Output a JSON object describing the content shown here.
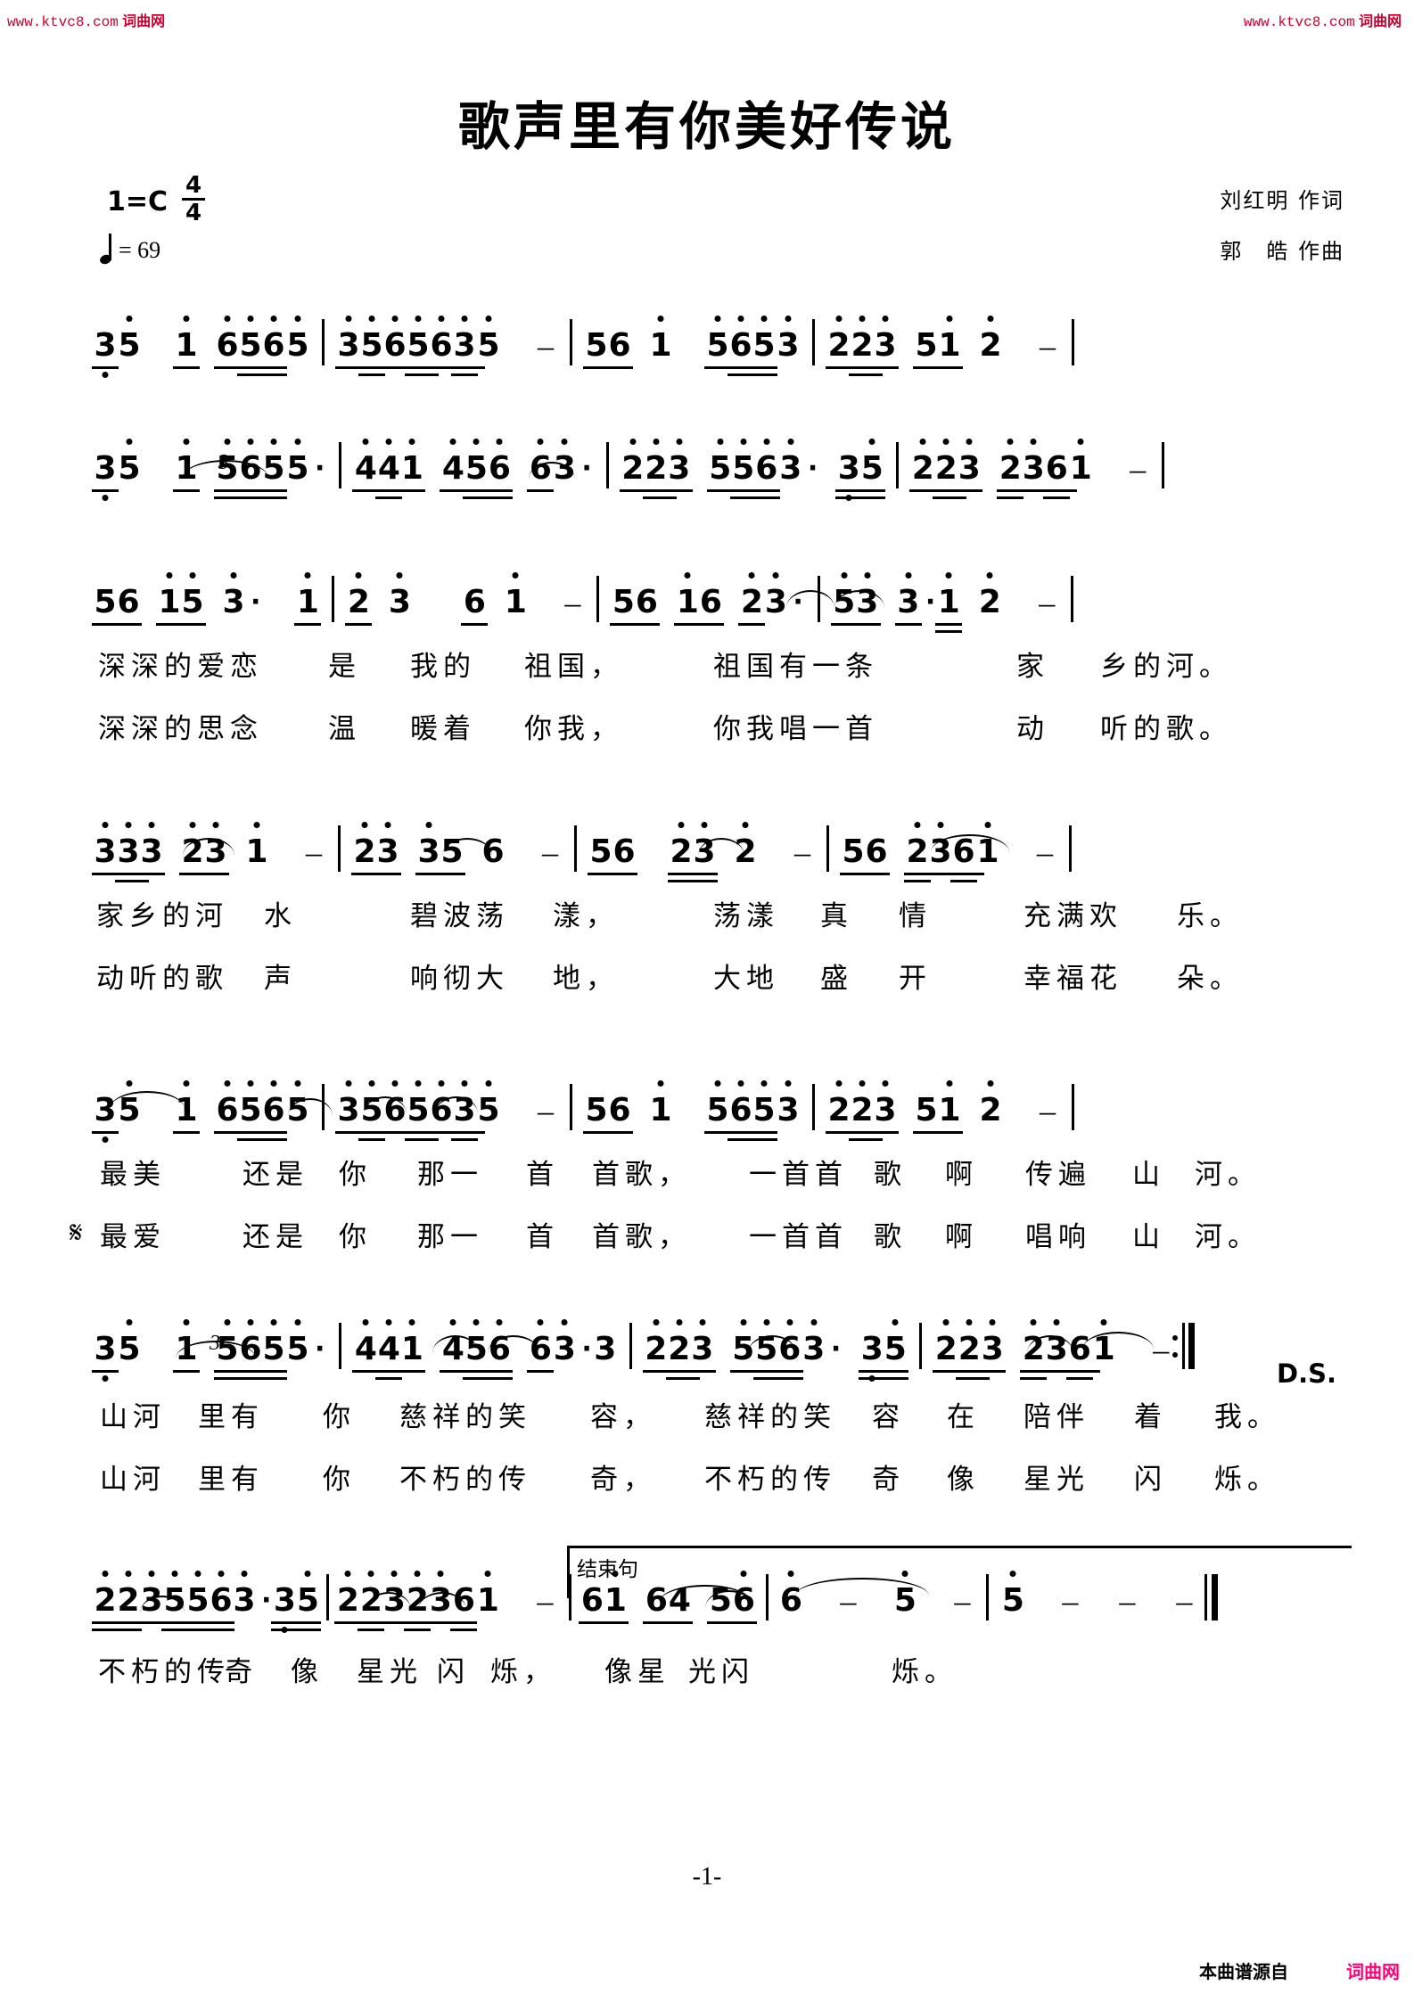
{
  "watermark": {
    "left_url": "www.ktvc8.com",
    "left_cn": "词曲网",
    "right_url": "www.ktvc8.com",
    "right_cn": "词曲网"
  },
  "header": {
    "title": "歌声里有你美好传说",
    "key_label": "1=C",
    "time_numerator": "4",
    "time_denominator": "4",
    "tempo_equals": "= 69",
    "lyricist": "刘红明 作词",
    "composer": "郭　皓 作曲"
  },
  "marks": {
    "segno": "𝄋",
    "ds": "D.S.",
    "ending_label": "结束句",
    "triplet": "3"
  },
  "page_number": "-1-",
  "footer": {
    "source_label": "本曲谱源自",
    "site_label": "词曲网"
  },
  "chart_data": {
    "type": "table",
    "title": "歌声里有你美好传说 — 简谱",
    "key": "1=C",
    "meter": "4/4",
    "tempo_bpm": 69,
    "systems": [
      {
        "index": 1,
        "measures": [
          [
            "3̣",
            "5̇",
            "1̇",
            "6",
            "5",
            "6",
            "5̇"
          ],
          [
            "3",
            "5",
            "6",
            "5",
            "6",
            "3",
            "5",
            "-"
          ],
          [
            "5",
            "6",
            "1̇",
            "5",
            "6",
            "5",
            "3"
          ],
          [
            "2̇",
            "2̇",
            "3",
            "5",
            "1",
            "2̇",
            "-"
          ]
        ],
        "lyrics": []
      },
      {
        "index": 2,
        "measures": [
          [
            "3̣",
            "5̇",
            "1̇",
            "5",
            "6",
            "5",
            "5",
            "."
          ],
          [
            "4",
            "4",
            "1",
            "4",
            "5",
            "6",
            "6",
            "3",
            "."
          ],
          [
            "2̇",
            "2̇",
            "3",
            "5",
            "5",
            "6",
            "3",
            ".",
            "3̣",
            "5"
          ],
          [
            "2̇",
            "2̇",
            "3̇",
            "2̇",
            "3",
            "6",
            "1̇",
            "-"
          ]
        ],
        "triplet_on": "measure 1 notes 5-6-5"
      },
      {
        "index": 3,
        "measures": [
          [
            "5",
            "6",
            "1̇",
            "5̇",
            "3̇",
            ".",
            "1̇"
          ],
          [
            "2̇",
            "3̇",
            "6",
            "1̇",
            "-"
          ],
          [
            "5",
            "6",
            "1̇",
            "6",
            "2̇",
            "3̇",
            "."
          ],
          [
            "5̇",
            "3̇",
            "3̇",
            ".",
            "1̇",
            "2̇",
            "-"
          ]
        ],
        "lyrics_line1": "深深的爱恋　是　我的　祖国，　祖国有一条　　家　乡的河。",
        "lyrics_line2": "深深的思念　温　暖着　你我，　你我唱一首　　动　听的歌。"
      },
      {
        "index": 4,
        "measures": [
          [
            "3̇",
            "3̇",
            "3̇",
            "2̇",
            "3̇",
            "1̇",
            "-"
          ],
          [
            "2̇",
            "3̇",
            "3̇",
            "5",
            "6",
            "-"
          ],
          [
            "5",
            "6",
            "2̇",
            "3̇",
            "2̇",
            "-"
          ],
          [
            "5",
            "6",
            "2̇",
            "3",
            "6",
            "1̇",
            "-"
          ]
        ],
        "lyrics_line1": "家乡的河　水　　碧波荡　漾，　荡漾　真　情　　充满欢　乐。",
        "lyrics_line2": "动听的歌　声　　响彻大　地，　大地　盛　开　　幸福花　朵。"
      },
      {
        "index": 5,
        "measures": [
          [
            "3̣",
            "5̇",
            "1̇",
            "6",
            "5",
            "6",
            "5̇"
          ],
          [
            "3",
            "5",
            "6",
            "5",
            "6",
            "3",
            "5",
            "-"
          ],
          [
            "5",
            "6",
            "1̇",
            "5",
            "6",
            "5",
            "3"
          ],
          [
            "2̇",
            "2̇",
            "3",
            "5",
            "1",
            "2̇",
            "-"
          ]
        ],
        "lyrics_line1": "最美　　还是　你　那一　首　首歌，　一首首　歌　啊　传遍　山　河。",
        "lyrics_line2": "最爱　　还是　你　那一　首　首歌，　一首首　歌　啊　唱响　山　河。"
      },
      {
        "index": 6,
        "measures": [
          [
            "3̣",
            "5̇",
            "1̇",
            "5",
            "6",
            "5",
            "5",
            "."
          ],
          [
            "4",
            "4",
            "1",
            "4",
            "5",
            "6",
            "6",
            "3",
            ".",
            "3"
          ],
          [
            "2̇",
            "2̇",
            "3",
            "5",
            "5",
            "6",
            "3",
            ".",
            "3̣",
            "5"
          ],
          [
            "2̇",
            "2̇",
            "3̇",
            "2̇",
            "3",
            "6",
            "1̇",
            "-"
          ]
        ],
        "lyrics_line1": "山河　里有　你　　慈祥的笑　　容，　慈祥的笑　容　在　陪伴　着　我。",
        "lyrics_line2": "山河　里有　你　　不朽的传　　奇，　不朽的传　奇　像　星光　闪　烁。",
        "end_mark": "D.S."
      },
      {
        "index": 7,
        "measures": [
          [
            "2̇",
            "2̇",
            "3",
            "5",
            "5",
            "6",
            "3",
            ".",
            "3̣",
            "5"
          ],
          [
            "2̇",
            "2̇",
            "3̇",
            "2̇",
            "3",
            "6",
            "1̇",
            "-"
          ],
          [
            "6",
            "1̇",
            "6",
            "4",
            "5",
            "6"
          ],
          [
            "6̇",
            "-",
            "5̇",
            "-"
          ],
          [
            "5̇",
            "-",
            "-",
            "-",
            "-"
          ]
        ],
        "lyrics_line1": "不朽的传　奇　像　星光　闪　烁，　像星　光闪　　　　烁。",
        "ending_bracket": "结束句"
      }
    ]
  },
  "lyrics": {
    "sys3": {
      "l1": [
        "深深的爱恋",
        "是",
        "我的",
        "祖国，",
        "祖国有一条",
        "家",
        "乡的河。"
      ],
      "l2": [
        "深深的思念",
        "温",
        "暖着",
        "你我，",
        "你我唱一首",
        "动",
        "听的歌。"
      ]
    },
    "sys4": {
      "l1": [
        "家乡的河",
        "水",
        "碧波荡",
        "漾，",
        "荡漾",
        "真",
        "情",
        "充满欢",
        "乐。"
      ],
      "l2": [
        "动听的歌",
        "声",
        "响彻大",
        "地，",
        "大地",
        "盛",
        "开",
        "幸福花",
        "朵。"
      ]
    },
    "sys5": {
      "l1": [
        "最美",
        "还是",
        "你",
        "那一",
        "首",
        "首歌，",
        "一首首",
        "歌",
        "啊",
        "传遍",
        "山",
        "河。"
      ],
      "l2": [
        "最爱",
        "还是",
        "你",
        "那一",
        "首",
        "首歌，",
        "一首首",
        "歌",
        "啊",
        "唱响",
        "山",
        "河。"
      ]
    },
    "sys6": {
      "l1": [
        "山河",
        "里有",
        "你",
        "慈祥的笑",
        "容，",
        "慈祥的笑",
        "容",
        "在",
        "陪伴",
        "着",
        "我。"
      ],
      "l2": [
        "山河",
        "里有",
        "你",
        "不朽的传",
        "奇，",
        "不朽的传",
        "奇",
        "像",
        "星光",
        "闪",
        "烁。"
      ]
    },
    "sys7": {
      "l1": [
        "不朽的传",
        "奇",
        "像",
        "星光",
        "闪",
        "烁，",
        "像星",
        "光闪",
        "烁。"
      ]
    }
  }
}
